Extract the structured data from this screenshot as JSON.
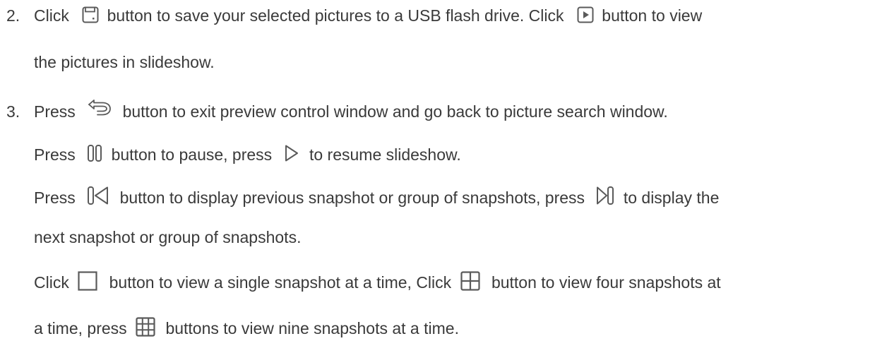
{
  "steps": [
    {
      "number": "2.",
      "line1": {
        "t1": "Click",
        "t2": "button to save your selected pictures to a USB flash drive. Click",
        "t3": "button to view"
      },
      "line2": "the pictures in slideshow."
    },
    {
      "number": "3.",
      "line1": {
        "t1": "Press",
        "t2": "button to exit preview control window and go back to picture search window."
      },
      "line2": {
        "t1": "Press",
        "t2": "button to pause, press",
        "t3": "to resume slideshow."
      },
      "line3": {
        "t1": "Press",
        "t2": "button to display previous snapshot or group of snapshots, press",
        "t3": "to display the"
      },
      "line4": "next snapshot or group of snapshots.",
      "line5": {
        "t1": "Click",
        "t2": "button to view a single snapshot at a time, Click",
        "t3": "button to view four snapshots at"
      },
      "line6": {
        "t1": "a time, press",
        "t2": "buttons to view nine snapshots at a time."
      }
    }
  ],
  "icons": {
    "save": "save-icon",
    "play": "play-icon",
    "back": "back-icon",
    "pause": "pause-icon",
    "resume": "resume-icon",
    "previous": "previous-icon",
    "next": "next-icon",
    "single": "single-view-icon",
    "four": "four-view-icon",
    "nine": "nine-view-icon"
  },
  "colors": {
    "text": "#3a3a3a",
    "icon": "#5a5a5a"
  }
}
